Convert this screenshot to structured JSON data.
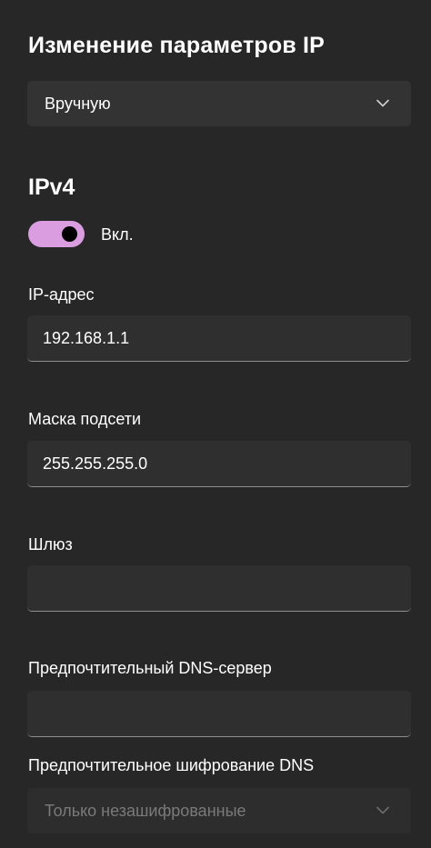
{
  "header": {
    "title": "Изменение параметров IP"
  },
  "mode_select": {
    "value": "Вручную"
  },
  "ipv4": {
    "title": "IPv4",
    "toggle": {
      "state": true,
      "label": "Вкл."
    },
    "fields": [
      {
        "label": "IP-адрес",
        "value": "192.168.1.1"
      },
      {
        "label": "Маска подсети",
        "value": "255.255.255.0"
      },
      {
        "label": "Шлюз",
        "value": ""
      },
      {
        "label": "Предпочтительный DNS-сервер",
        "value": ""
      }
    ],
    "dns_encryption": {
      "label": "Предпочтительное шифрование DNS",
      "value": "Только незашифрованные",
      "disabled": true
    }
  },
  "colors": {
    "background": "#272727",
    "toggle_on": "#d99de0",
    "field_bg": "#2f2f2f"
  }
}
